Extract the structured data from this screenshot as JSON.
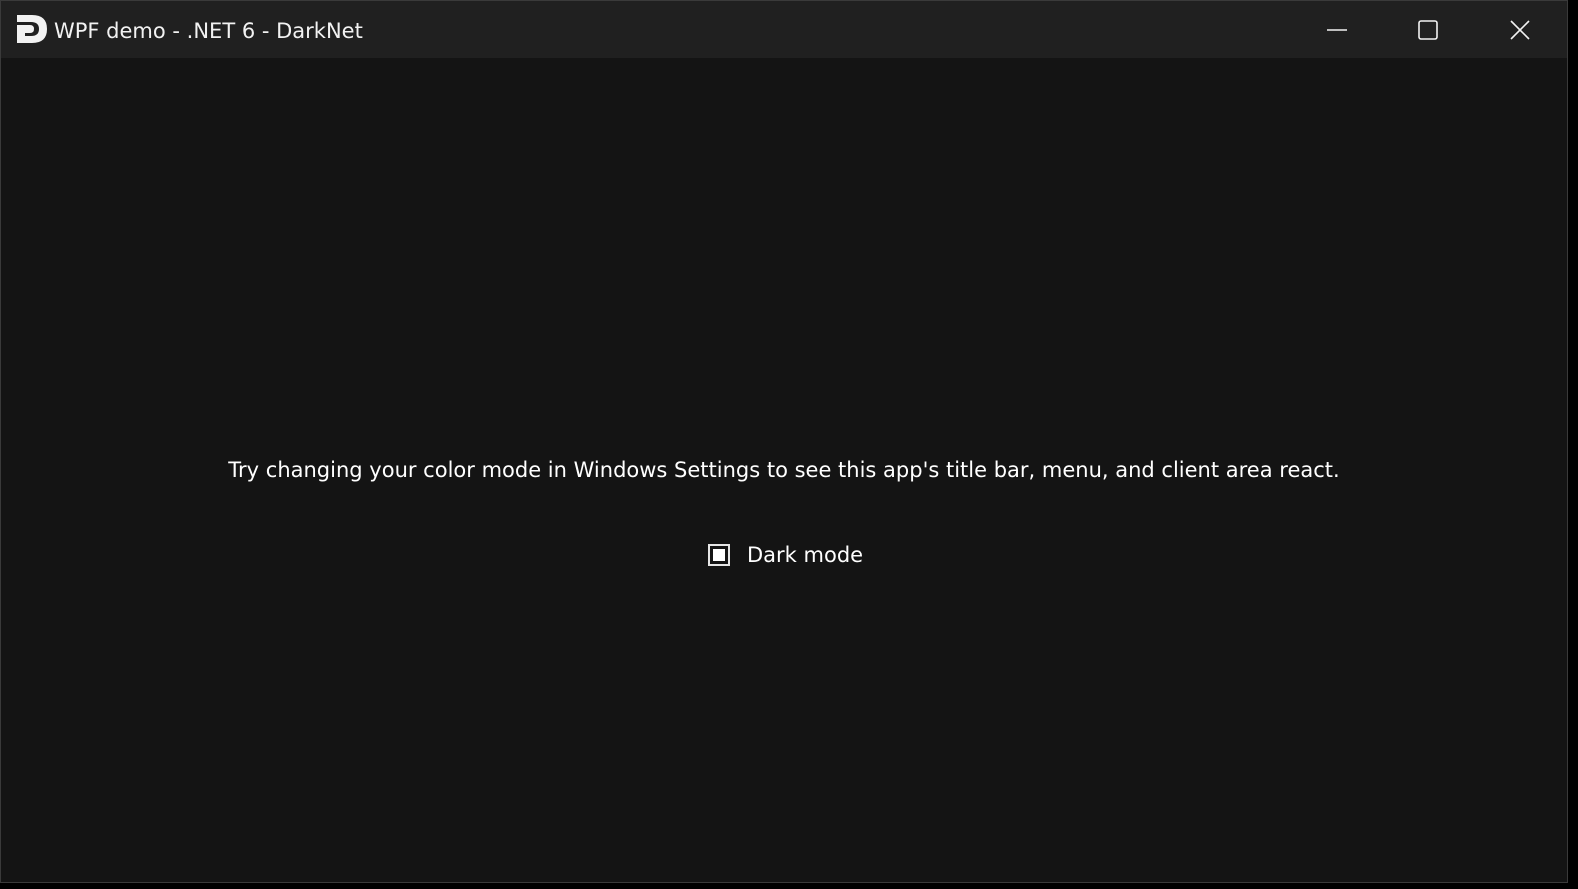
{
  "window": {
    "title": "WPF demo - .NET 6 - DarkNet",
    "icon": "darknet-logo-icon",
    "controls": {
      "minimize_icon": "minimize-icon",
      "maximize_icon": "maximize-icon",
      "close_icon": "close-icon"
    }
  },
  "main": {
    "hint": "Try changing your color mode in Windows Settings to see this app's title bar, menu, and client area react.",
    "dark_mode_checkbox": {
      "label": "Dark mode",
      "state": "indeterminate"
    }
  },
  "colors": {
    "titlebar_bg": "#202020",
    "client_bg": "#141414",
    "text": "#ffffff"
  }
}
